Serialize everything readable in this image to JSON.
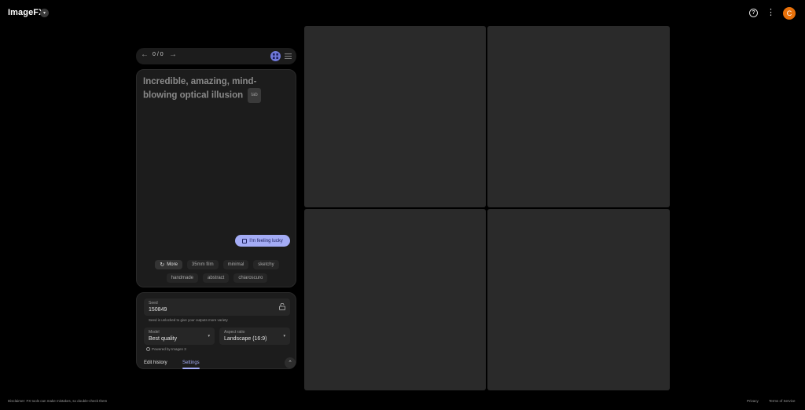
{
  "header": {
    "brand": "ImageFX",
    "brand_caret": "▾",
    "help_glyph": "?",
    "menu_glyph": "⋮",
    "avatar_initial": "C"
  },
  "navigator": {
    "prev_glyph": "←",
    "count": "0 / 0",
    "next_glyph": "→"
  },
  "prompt": {
    "text": "Incredible, amazing, mind-blowing optical illusion",
    "tab_hint": "tab",
    "lucky_label": "I'm feeling lucky"
  },
  "chips": {
    "more_label": "More",
    "refresh_glyph": "↻",
    "row1": [
      "35mm film",
      "minimal",
      "sketchy"
    ],
    "row2": [
      "handmade",
      "abstract",
      "chiaroscuro"
    ]
  },
  "settings": {
    "seed_label": "Seed",
    "seed_value": "150849",
    "seed_hint": "Seed is unlocked to give your outputs more variety",
    "model_label": "Model",
    "model_value": "Best quality",
    "aspect_label": "Aspect ratio",
    "aspect_value": "Landscape (16:9)",
    "caret_glyph": "▾",
    "powered_by": "Powered by Imagen 3",
    "tab_edit_history": "Edit history",
    "tab_settings": "Settings",
    "active_tab": "Settings",
    "collapse_glyph": "⌃"
  },
  "footer": {
    "disclaimer": "Disclaimer: FX tools can make mistakes, so double-check them",
    "privacy": "Privacy",
    "terms": "Terms of Service"
  },
  "colors": {
    "background": "#000000",
    "panel": "#1c1c1c",
    "tile": "#2a2a2a",
    "accent": "#a4acf5",
    "avatar": "#e8710a"
  }
}
